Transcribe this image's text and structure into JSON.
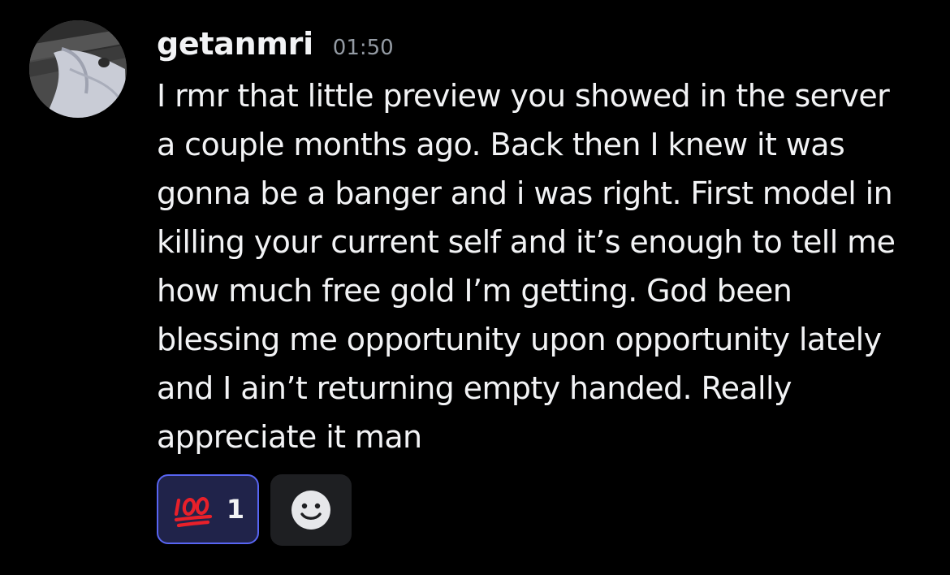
{
  "message": {
    "author": {
      "username": "getanmri",
      "avatar_icon": "profile-photo-avatar"
    },
    "timestamp": "01:50",
    "lines": [
      "I rmr that little preview you showed in the server",
      "a couple months ago. Back then I knew it was",
      "gonna be a banger and i was right. First model in",
      "killing your current self and it’s enough to tell me",
      "how much free gold I’m getting. God been",
      "blessing me opportunity upon opportunity lately",
      "and I ain’t returning empty handed. Really",
      "appreciate it man"
    ],
    "reactions": [
      {
        "emoji": "💯",
        "emoji_name": "hundred-points-emoji",
        "count": "1",
        "selected": true
      }
    ],
    "add_reaction_icon": "add-reaction-smiley-icon"
  },
  "colors": {
    "background": "#000000",
    "text": "#f2f3f5",
    "timestamp": "#949ba4",
    "reaction_selected_border": "#5865f2",
    "reaction_selected_bg": "#20234a",
    "add_reaction_bg": "#1e1f22",
    "hundred_emoji": "#e8202a"
  }
}
